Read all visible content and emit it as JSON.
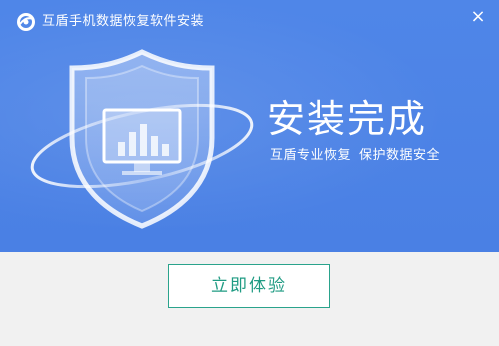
{
  "window": {
    "title": "互盾手机数据恢复软件安装",
    "close_symbol": "×",
    "logo_icon": "app-logo-icon",
    "close_icon": "close-icon"
  },
  "hero": {
    "headline": "安装完成",
    "subtitle_part1": "互盾专业恢复",
    "subtitle_part2": "保护数据安全",
    "illustration_icon": "shield-monitor-icon"
  },
  "footer": {
    "action_label": "立即体验"
  },
  "colors": {
    "hero_background": "#4f86e8",
    "footer_background": "#f1f1f1",
    "button_border": "#2aa38c",
    "button_text": "#1f9b83"
  }
}
